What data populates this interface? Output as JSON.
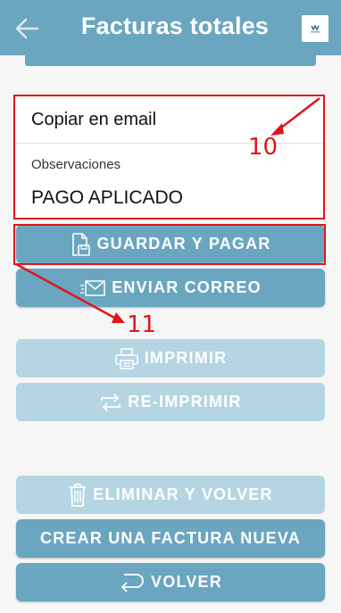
{
  "header": {
    "title": "Facturas totales",
    "back_icon": "arrow-left-icon",
    "logo_icon": "app-logo-icon",
    "color": "#6aa6bf"
  },
  "form": {
    "copy_email_label": "Copiar en email",
    "observations_label": "Observaciones",
    "observations_value": "PAGO APLICADO"
  },
  "buttons": {
    "save_pay": {
      "label": "GUARDAR Y PAGAR",
      "icon": "document-save-icon",
      "enabled": true
    },
    "send_email": {
      "label": "ENVIAR CORREO",
      "icon": "envelope-icon",
      "enabled": true
    },
    "print": {
      "label": "IMPRIMIR",
      "icon": "printer-icon",
      "enabled": false
    },
    "reprint": {
      "label": "RE-IMPRIMIR",
      "icon": "repeat-icon",
      "enabled": false
    },
    "delete_back": {
      "label": "ELIMINAR Y VOLVER",
      "icon": "trash-icon",
      "enabled": false
    },
    "new_invoice": {
      "label": "CREAR UNA FACTURA NUEVA",
      "icon": "",
      "enabled": true
    },
    "back": {
      "label": "VOLVER",
      "icon": "return-arrow-icon",
      "enabled": true
    }
  },
  "annotations": {
    "callout_10": "10",
    "callout_11": "11",
    "color": "#e0161b"
  }
}
